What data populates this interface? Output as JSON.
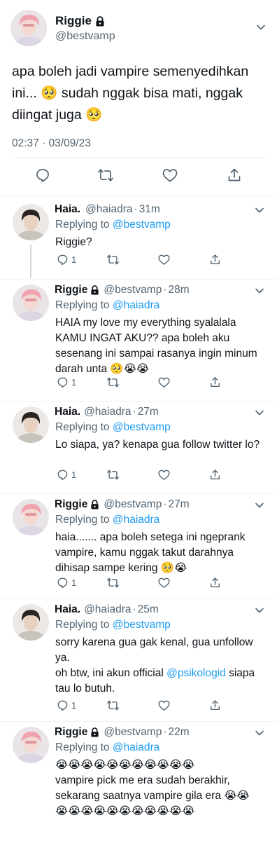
{
  "main_tweet": {
    "name": "Riggie",
    "handle": "@bestvamp",
    "text": "apa boleh jadi vampire semenyedihkan ini... 🥺 sudah nggak bisa mati, nggak diingat juga 🥺",
    "timestamp": "02:37 · 03/09/23",
    "avatar": "riggie-avatar",
    "icons": [
      "lock-icon",
      "chevron-down-icon",
      "reply-icon",
      "retweet-icon",
      "like-icon",
      "share-icon"
    ]
  },
  "replies": [
    {
      "name": "Haia.",
      "handle": "@haiadra",
      "time": "31m",
      "replying_label": "Replying to",
      "replying_to": "@bestvamp",
      "text": "Riggie?",
      "reply_count": "1",
      "locked": false,
      "avatar": "haia-avatar"
    },
    {
      "name": "Riggie",
      "handle": "@bestvamp",
      "time": "28m",
      "replying_label": "Replying to",
      "replying_to": "@haiadra",
      "text": "HAIA my love my everything syalalala KAMU INGAT AKU?? apa boleh aku sesenang ini sampai rasanya ingin minum darah unta 🥺😭😭",
      "reply_count": "1",
      "locked": true,
      "avatar": "riggie-avatar"
    },
    {
      "name": "Haia.",
      "handle": "@haiadra",
      "time": "27m",
      "replying_label": "Replying to",
      "replying_to": "@bestvamp",
      "text": "Lo siapa, ya? kenapa gua follow twitter lo?",
      "reply_count": "1",
      "locked": false,
      "avatar": "haia-avatar"
    },
    {
      "name": "Riggie",
      "handle": "@bestvamp",
      "time": "27m",
      "replying_label": "Replying to",
      "replying_to": "@haiadra",
      "text": "haia....... apa boleh setega ini ngeprank vampire, kamu nggak takut darahnya dihisap sampe kering 🥺😭",
      "reply_count": "1",
      "locked": true,
      "avatar": "riggie-avatar"
    },
    {
      "name": "Haia.",
      "handle": "@haiadra",
      "time": "25m",
      "replying_label": "Replying to",
      "replying_to": "@bestvamp",
      "text_line1": "sorry karena gua gak kenal, gua unfollow ya.",
      "text_line2_prefix": "oh btw, ini akun official ",
      "text_line2_mention": "@psikologid",
      "text_line2_suffix": " siapa tau lo butuh.",
      "reply_count": "1",
      "locked": false,
      "avatar": "haia-avatar"
    },
    {
      "name": "Riggie",
      "handle": "@bestvamp",
      "time": "22m",
      "replying_label": "Replying to",
      "replying_to": "@haiadra",
      "text_line1": "😭😭😭😭😭😭😭😭😭😭😭",
      "text_line2": "vampire pick me era sudah berakhir, sekarang saatnya vampire gila era 😭😭",
      "text_line3": "😭😭😭😭😭😭😭😭😭😭😭",
      "locked": true,
      "avatar": "riggie-avatar"
    }
  ],
  "colors": {
    "text": "#0f1419",
    "secondary": "#536471",
    "accent": "#1d9bf0",
    "divider": "#eff3f4",
    "thread_line": "#cfd9de"
  }
}
